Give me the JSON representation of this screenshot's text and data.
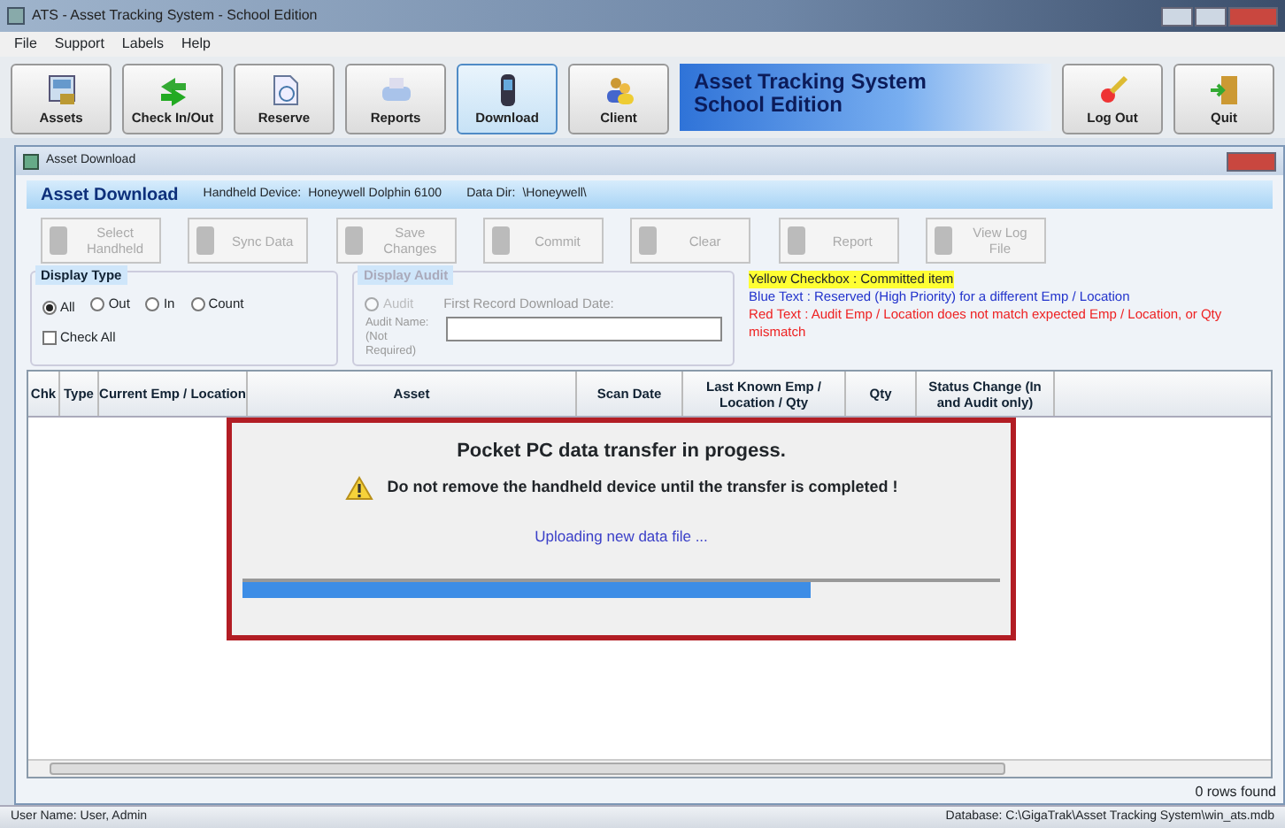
{
  "window": {
    "title": "ATS - Asset Tracking System - School Edition"
  },
  "menu": [
    "File",
    "Support",
    "Labels",
    "Help"
  ],
  "toolbar": [
    {
      "label": "Assets",
      "selected": false
    },
    {
      "label": "Check In/Out",
      "selected": false
    },
    {
      "label": "Reserve",
      "selected": false
    },
    {
      "label": "Reports",
      "selected": false
    },
    {
      "label": "Download",
      "selected": true
    },
    {
      "label": "Client",
      "selected": false
    }
  ],
  "banner": [
    "Asset Tracking System",
    "School Edition"
  ],
  "toolbar_right": [
    {
      "label": "Log Out"
    },
    {
      "label": "Quit"
    }
  ],
  "child_window": {
    "title": "Asset Download"
  },
  "header": {
    "title": "Asset Download",
    "device_label": "Handheld Device:",
    "device": "Honeywell Dolphin 6100",
    "dir_label": "Data Dir:",
    "dir": "\\Honeywell\\"
  },
  "actions": [
    {
      "label": "Select Handheld",
      "disabled": true
    },
    {
      "label": "Sync Data",
      "disabled": true
    },
    {
      "label": "Save Changes",
      "disabled": true
    },
    {
      "label": "Commit",
      "disabled": true
    },
    {
      "label": "Clear",
      "disabled": true
    },
    {
      "label": "Report",
      "disabled": true
    },
    {
      "label": "View Log File",
      "disabled": true
    }
  ],
  "display_type": {
    "title": "Display Type",
    "options": [
      {
        "label": "All",
        "selected": true
      },
      {
        "label": "Out",
        "selected": false
      },
      {
        "label": "In",
        "selected": false
      },
      {
        "label": "Count",
        "selected": false
      }
    ],
    "check_all": {
      "label": "Check All",
      "checked": false
    }
  },
  "display_audit": {
    "title": "Display Audit",
    "audit": {
      "label": "Audit",
      "selected": false,
      "disabled": true
    },
    "first_record_label": "First Record Download Date:",
    "audit_name_label": "Audit Name:",
    "audit_name_note": "(Not Required)"
  },
  "legend": [
    {
      "kind": "highlight",
      "text": "Yellow Checkbox :  Committed item",
      "color": "#ffff33"
    },
    {
      "kind": "text",
      "text": "Blue Text :  Reserved (High Priority) for a different Emp / Location",
      "color": "#2233cc"
    },
    {
      "kind": "text",
      "text": "Red Text :  Audit Emp / Location does not match expected Emp / Location, or Qty mismatch",
      "color": "#ee2222"
    }
  ],
  "table": {
    "columns": [
      "Chk",
      "Type",
      "Current Emp / Location",
      "Asset",
      "Scan Date",
      "Last Known Emp / Location / Qty",
      "Qty",
      "Status Change (In and Audit only)"
    ]
  },
  "dialog": {
    "title": "Pocket PC data transfer in progess.",
    "message": "Do not remove the handheld device until the transfer is completed !",
    "status": "Uploading new data file ...",
    "level": 0.75
  },
  "rows_found": "0 rows found",
  "status_bar": {
    "user": "User Name:  User, Admin",
    "database": "Database:  C:\\GigaTrak\\Asset Tracking System\\win_ats.mdb"
  }
}
